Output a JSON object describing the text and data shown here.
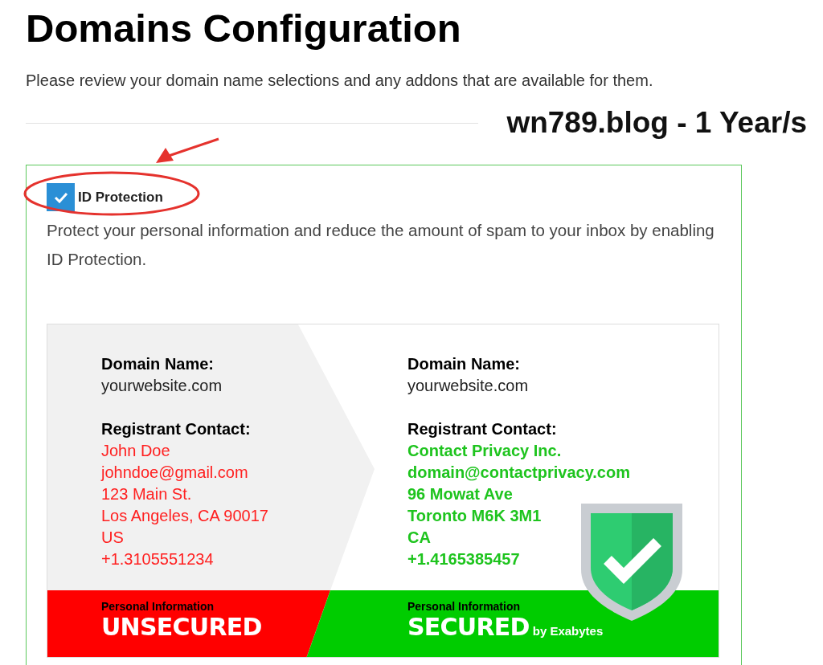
{
  "page": {
    "title": "Domains Configuration",
    "subtitle": "Please review your domain name selections and any addons that are available for them."
  },
  "domain_heading": "wn789.blog - 1 Year/s",
  "addon": {
    "label": "ID Protection",
    "checked": true,
    "description": "Protect your personal information and reduce the amount of spam to your inbox by enabling ID Protection."
  },
  "banner": {
    "columns": [
      {
        "kind": "unsecured",
        "domain_label": "Domain Name:",
        "domain": "yourwebsite.com",
        "contact_label": "Registrant Contact:",
        "contact_lines": [
          "John Doe",
          "johndoe@gmail.com",
          "123 Main St.",
          "Los Angeles, CA 90017",
          "US",
          "+1.3105551234"
        ],
        "status_caption": "Personal Information",
        "status": "UNSECURED"
      },
      {
        "kind": "secured",
        "domain_label": "Domain Name:",
        "domain": "yourwebsite.com",
        "contact_label": "Registrant Contact:",
        "contact_lines": [
          "Contact Privacy Inc.",
          "domain@contactprivacy.com",
          "96 Mowat Ave",
          "Toronto M6K 3M1",
          "CA",
          "+1.4165385457"
        ],
        "status_caption": "Personal Information",
        "status": "SECURED",
        "byline": "by Exabytes"
      }
    ]
  }
}
